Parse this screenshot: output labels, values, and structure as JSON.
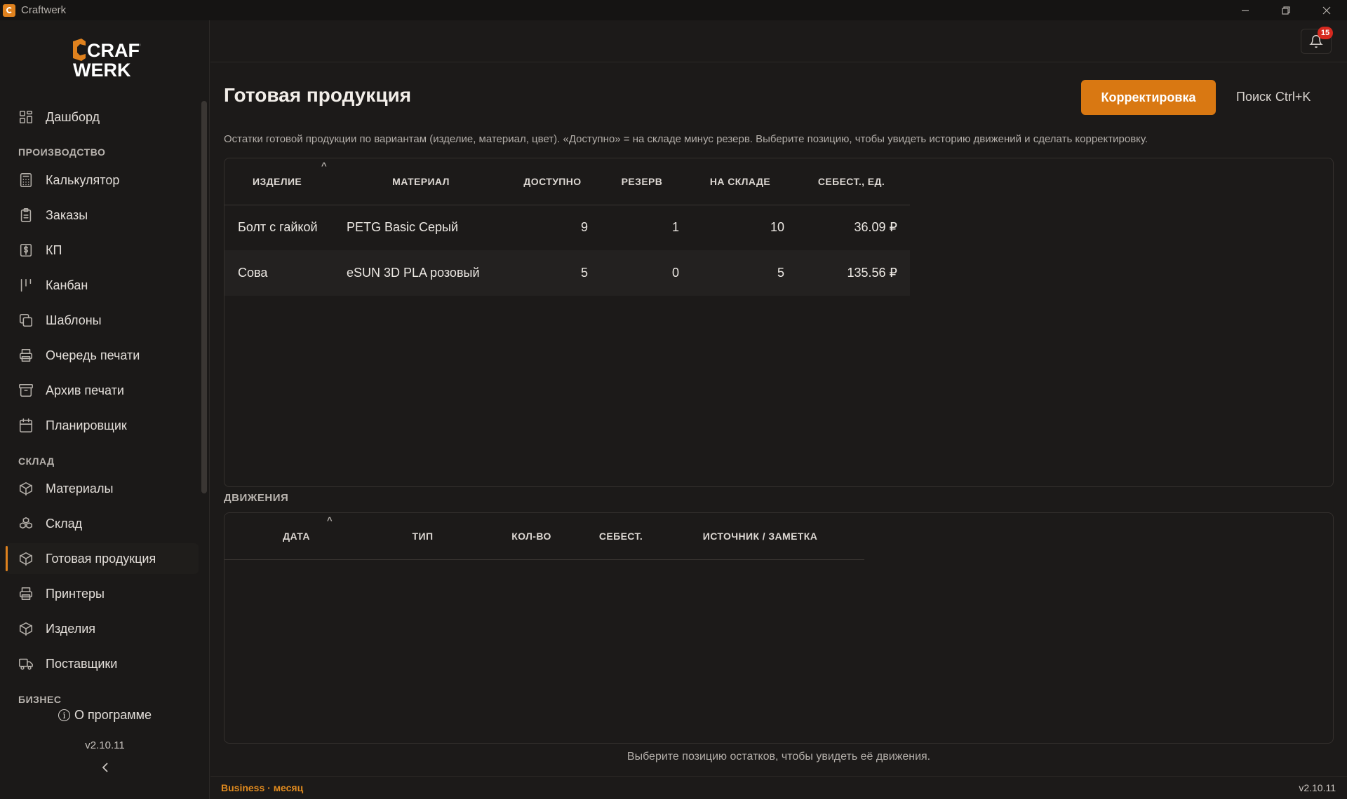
{
  "window": {
    "title": "Craftwerk"
  },
  "logo": {
    "line1": "CRAFT",
    "line2": "WERK"
  },
  "sidebar": {
    "top_item": {
      "label": "Дашборд",
      "icon": "dashboard-icon"
    },
    "sections": [
      {
        "title": "ПРОИЗВОДСТВО",
        "items": [
          {
            "label": "Калькулятор",
            "icon": "calculator-icon"
          },
          {
            "label": "Заказы",
            "icon": "clipboard-icon"
          },
          {
            "label": "КП",
            "icon": "dollar-doc-icon"
          },
          {
            "label": "Канбан",
            "icon": "kanban-icon"
          },
          {
            "label": "Шаблоны",
            "icon": "copy-icon"
          },
          {
            "label": "Очередь печати",
            "icon": "printer-icon"
          },
          {
            "label": "Архив печати",
            "icon": "archive-icon"
          },
          {
            "label": "Планировщик",
            "icon": "calendar-icon"
          }
        ]
      },
      {
        "title": "СКЛАД",
        "items": [
          {
            "label": "Материалы",
            "icon": "box-icon"
          },
          {
            "label": "Склад",
            "icon": "boxes-icon"
          },
          {
            "label": "Готовая продукция",
            "icon": "box-icon",
            "active": true
          },
          {
            "label": "Принтеры",
            "icon": "printer-icon"
          },
          {
            "label": "Изделия",
            "icon": "box-icon"
          },
          {
            "label": "Поставщики",
            "icon": "truck-icon"
          }
        ]
      },
      {
        "title": "БИЗНЕС",
        "items": []
      }
    ],
    "about": "О программе",
    "version": "v2.10.11",
    "collapse_icon": "chevron-left-icon"
  },
  "notifications": {
    "count": "15"
  },
  "page": {
    "title": "Готовая продукция",
    "adjust_button": "Корректировка",
    "search_label": "Поиск",
    "search_shortcut": "Ctrl+K",
    "subtitle": "Остатки готовой продукции по вариантам (изделие, материал, цвет). «Доступно» = на складе минус резерв. Выберите позицию, чтобы увидеть историю движений и сделать корректировку."
  },
  "stock_table": {
    "columns": [
      "ИЗДЕЛИЕ",
      "МАТЕРИАЛ",
      "ДОСТУПНО",
      "РЕЗЕРВ",
      "НА СКЛАДЕ",
      "СЕБЕСТ., ЕД."
    ],
    "rows": [
      [
        "Болт с гайкой",
        "PETG Basic Серый",
        "9",
        "1",
        "10",
        "36.09 ₽"
      ],
      [
        "Сова",
        "eSUN 3D PLA розовый",
        "5",
        "0",
        "5",
        "135.56 ₽"
      ]
    ]
  },
  "movements": {
    "label": "ДВИЖЕНИЯ",
    "columns": [
      "ДАТА",
      "ТИП",
      "КОЛ-ВО",
      "СЕБЕСТ.",
      "ИСТОЧНИК / ЗАМЕТКА"
    ],
    "empty_hint": "Выберите позицию остатков, чтобы увидеть её движения."
  },
  "status": {
    "plan": "Business · месяц",
    "version": "v2.10.11"
  },
  "colors": {
    "accent": "#d97812",
    "badge": "#d6291f",
    "background": "#1c1a19"
  }
}
